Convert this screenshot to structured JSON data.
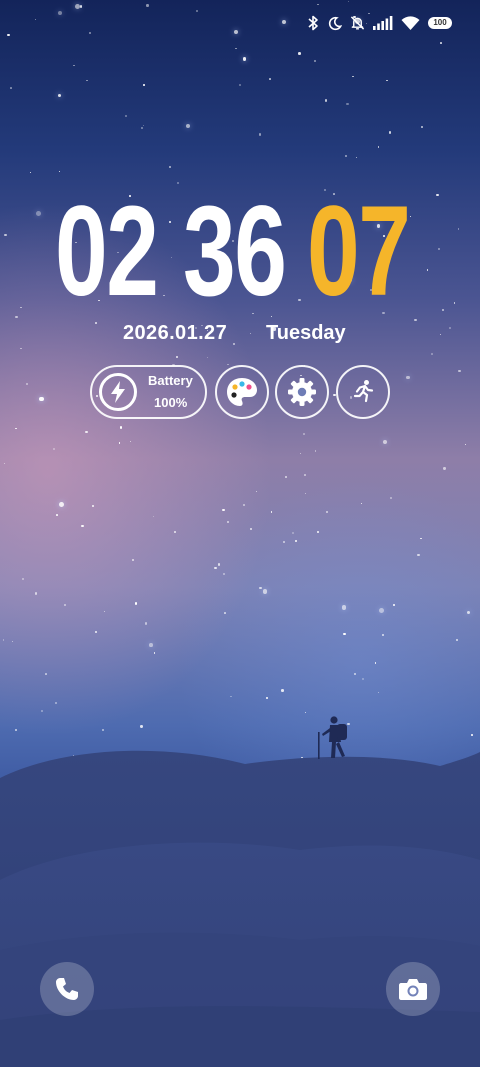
{
  "status_bar": {
    "icons": [
      "bluetooth-icon",
      "moon-icon",
      "bell-off-icon",
      "signal-icon",
      "wifi-icon"
    ],
    "battery_level": "100"
  },
  "clock": {
    "hours": "02",
    "minutes": "36",
    "seconds": "07",
    "seconds_color": "#f5b52a"
  },
  "date": {
    "date": "2026.01.27",
    "weekday": "Tuesday"
  },
  "widgets": {
    "battery": {
      "label": "Battery",
      "value": "100%",
      "icon": "lightning-icon"
    },
    "buttons": [
      "palette-icon",
      "gear-icon",
      "running-person-icon"
    ]
  },
  "shortcuts": {
    "left_icon": "phone-icon",
    "right_icon": "camera-icon"
  }
}
